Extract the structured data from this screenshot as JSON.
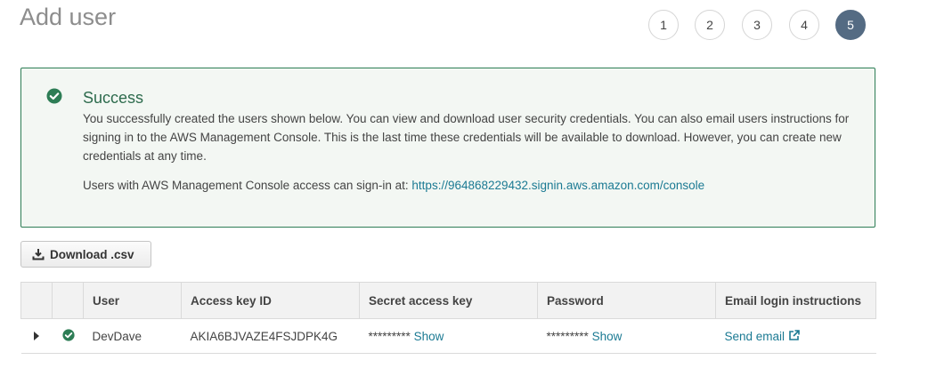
{
  "page": {
    "title": "Add user"
  },
  "steps": [
    {
      "label": "1",
      "active": false
    },
    {
      "label": "2",
      "active": false
    },
    {
      "label": "3",
      "active": false
    },
    {
      "label": "4",
      "active": false
    },
    {
      "label": "5",
      "active": true
    }
  ],
  "alert": {
    "title": "Success",
    "body": "You successfully created the users shown below. You can view and download user security credentials. You can also email users instructions for signing in to the AWS Management Console. This is the last time these credentials will be available to download. However, you can create new credentials at any time.",
    "signin_prefix": "Users with AWS Management Console access can sign-in at: ",
    "signin_url": "https://964868229432.signin.aws.amazon.com/console",
    "icon": "check-circle-icon",
    "color": "#2d7d55"
  },
  "download_button": {
    "label": "Download .csv",
    "icon": "download-icon"
  },
  "table": {
    "columns": [
      "",
      "",
      "User",
      "Access key ID",
      "Secret access key",
      "Password",
      "Email login instructions"
    ],
    "rows": [
      {
        "user": "DevDave",
        "access_key_id": "AKIA6BJVAZE4FSJDPK4G",
        "secret_mask": "*********",
        "secret_show": "Show",
        "password_mask": "*********",
        "password_show": "Show",
        "email_link": "Send email"
      }
    ]
  },
  "colors": {
    "accent": "#546b83",
    "link": "#1b7a93",
    "success": "#2d7d55"
  }
}
